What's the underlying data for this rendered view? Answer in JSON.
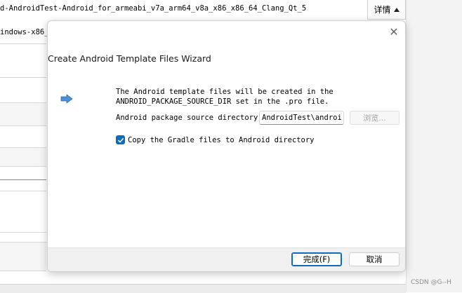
{
  "background": {
    "line1": "d-AndroidTest-Android_for_armeabi_v7a_arm64_v8a_x86_x86_64_Clang_Qt_5",
    "line2": "indows-x86_",
    "details_label": "详情"
  },
  "dialog": {
    "close_glyph": "✕",
    "title": "Create Android Template Files Wizard",
    "info_line1": "The Android template files will be created in the",
    "info_line2": "ANDROID_PACKAGE_SOURCE_DIR set in the .pro file.",
    "package_label": "Android package source directory:",
    "package_value": "AndroidTest\\android",
    "browse_label": "浏览...",
    "copy_gradle_label": "Copy the Gradle files to Android directory",
    "copy_gradle_checked": true,
    "finish_label": "完成(F)",
    "cancel_label": "取消"
  },
  "watermark": "CSDN @G--H",
  "colors": {
    "accent": "#0f6cbd",
    "arrow": "#4a8fd8"
  }
}
